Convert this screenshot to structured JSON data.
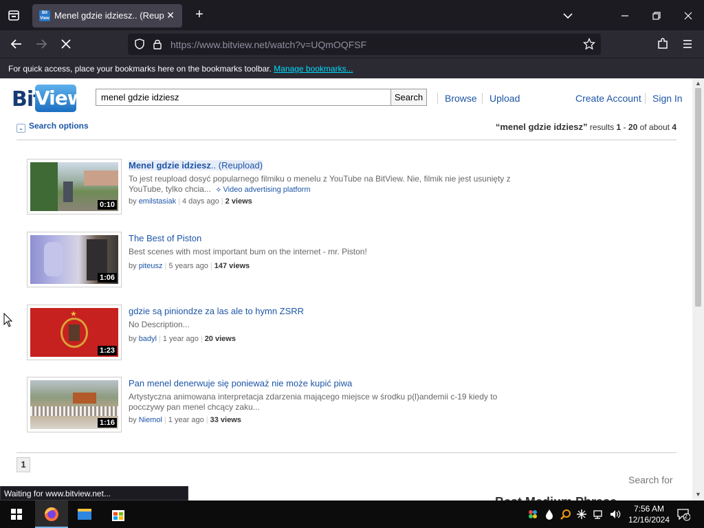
{
  "browser": {
    "tab_title": "Menel gdzie idziesz.. (Reupload)",
    "favicon_text": "Bit View",
    "url": "https://www.bitview.net/watch?v=UQmOQFSF",
    "bookmarks_message": "For quick access, place your bookmarks here on the bookmarks toolbar.",
    "bookmarks_link": "Manage bookmarks...",
    "status": "Waiting for www.bitview.net..."
  },
  "site": {
    "logo_bit": "Bit",
    "logo_view": "View",
    "search_value": "menel gdzie idziesz",
    "search_button": "Search",
    "nav": {
      "browse": "Browse",
      "upload": "Upload",
      "create_account": "Create Account",
      "sign_in": "Sign In"
    },
    "search_options": "Search options",
    "summary": {
      "query": "“menel gdzie idziesz”",
      "results_word": "results",
      "from": "1",
      "dash": "-",
      "to": "20",
      "of_about": "of about",
      "total": "4"
    }
  },
  "results": [
    {
      "title_main": "Menel gdzie idziesz",
      "title_rest": ".. (Reupload)",
      "description": "To jest reupload dosyć popularnego filmiku o menelu z YouTube na BitView. Nie, filmik nie jest usunięty z YouTube, tylko chcia...",
      "ad_tag": "Video advertising platform",
      "duration": "0:10",
      "by": "by",
      "user": "emilstasiak",
      "age": "4 days ago",
      "views": "2 views"
    },
    {
      "title_main": "The Best of Piston",
      "title_rest": "",
      "description": "Best scenes with most important bum on the internet - mr. Piston!",
      "duration": "1:06",
      "by": "by",
      "user": "piteusz",
      "age": "5 years ago",
      "views": "147 views"
    },
    {
      "title_main": "gdzie są piniondze za las ale to hymn ZSRR",
      "title_rest": "",
      "description": "No Description...",
      "duration": "1:23",
      "by": "by",
      "user": "badyl",
      "age": "1 year ago",
      "views": "20 views"
    },
    {
      "title_main": "Pan menel denerwuje się ponieważ nie może kupić piwa",
      "title_rest": "",
      "description": "Artystyczna animowana interpretacja zdarzenia mającego miejsce w środku p(l)andemii c-19 kiedy to pocczywy pan menel chcący zaku...",
      "duration": "1:16",
      "by": "by",
      "user": "Niemol",
      "age": "1 year ago",
      "views": "33 views"
    }
  ],
  "pagination": {
    "current": "1"
  },
  "sidebar": {
    "search_for": "Search for",
    "cut_heading": "Best Medium Phrase"
  },
  "taskbar": {
    "time": "7:56 AM",
    "date": "12/16/2024",
    "notifications": "2"
  },
  "colors": {
    "link": "#1d55a6",
    "chrome_dark": "#1c1b22",
    "chrome_toolbar": "#2b2a33"
  }
}
